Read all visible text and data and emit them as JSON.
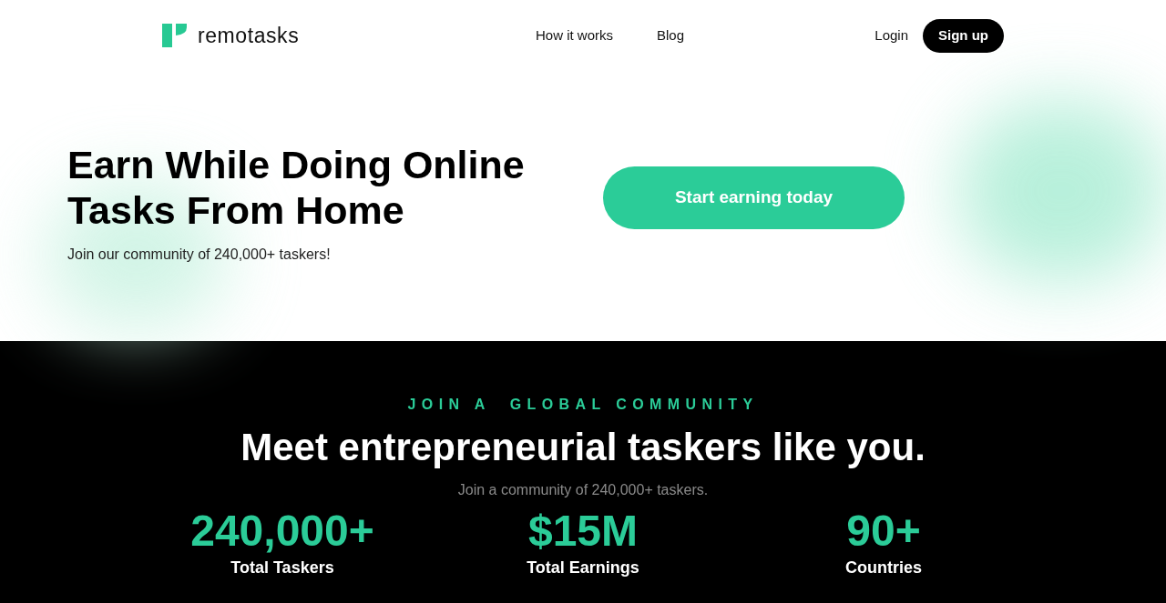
{
  "header": {
    "logo_text": "remotasks",
    "nav": [
      "How it works",
      "Blog"
    ],
    "login": "Login",
    "signup": "Sign up"
  },
  "hero": {
    "title_lines": [
      "Earn While Doing Online",
      "Tasks From Home"
    ],
    "subtitle": "Join our community of 240,000+ taskers!",
    "cta": "Start earning today"
  },
  "community": {
    "eyebrow": "JOIN A  GLOBAL COMMUNITY",
    "title": "Meet entrepreneurial taskers like you.",
    "subtitle": "Join a community of 240,000+ taskers.",
    "stats": [
      {
        "value": "240,000+",
        "label": "Total Taskers"
      },
      {
        "value": "$15M",
        "label": "Total Earnings"
      },
      {
        "value": "90+",
        "label": "Countries"
      }
    ]
  }
}
